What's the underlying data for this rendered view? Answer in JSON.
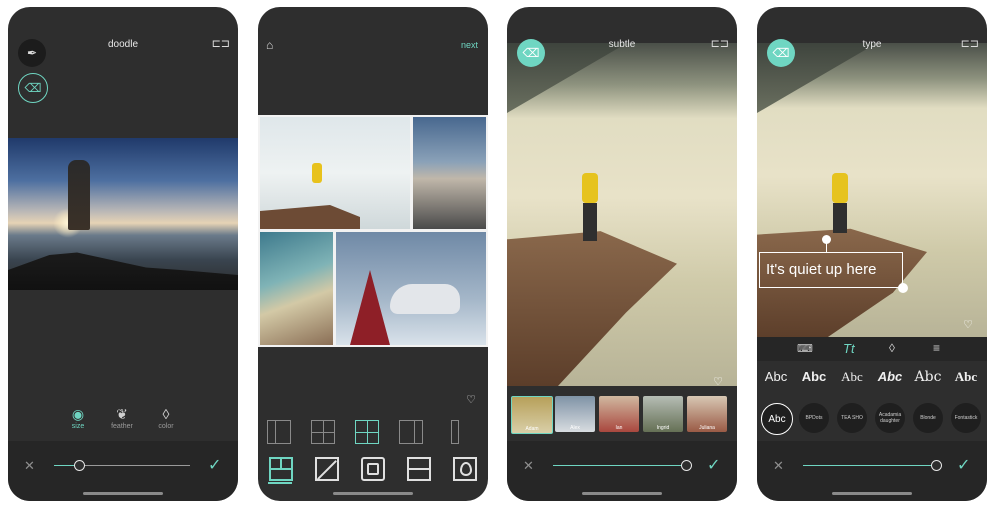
{
  "accent_color": "#6fd6c2",
  "panel_color": "#2e2e2e",
  "screens": [
    {
      "title": "doodle",
      "tools": [
        {
          "label": "size",
          "icon": "target-icon",
          "active": true
        },
        {
          "label": "feather",
          "icon": "feather-icon",
          "active": false
        },
        {
          "label": "color",
          "icon": "droplet-icon",
          "active": false
        }
      ],
      "slider_value": 0.12
    },
    {
      "next_label": "next",
      "layouts": [
        "layout-2col",
        "layout-4grid",
        "layout-mixed",
        "layout-split",
        "layout-strip"
      ],
      "actions": [
        "grid-icon",
        "expand-icon",
        "frame-icon",
        "rows-icon",
        "drop-frame-icon"
      ]
    },
    {
      "title": "subtle",
      "filters": [
        "Adam",
        "Alex",
        "Ian",
        "Ingrid",
        "Juliana"
      ],
      "slider_value": 0.98
    },
    {
      "title": "type",
      "caption": "It's quiet up here",
      "tabs": [
        "keyboard-icon",
        "text-style-icon",
        "droplet-icon",
        "align-icon"
      ],
      "font_samples": [
        "Abc",
        "Abc",
        "Abc",
        "Abc",
        "Abc",
        "Abc"
      ],
      "font_chips": [
        "Abc",
        "BPDots",
        "TEA SHO",
        "Acadamia daughter",
        "Blonde",
        "Fontastick"
      ],
      "slider_value": 0.98
    }
  ]
}
